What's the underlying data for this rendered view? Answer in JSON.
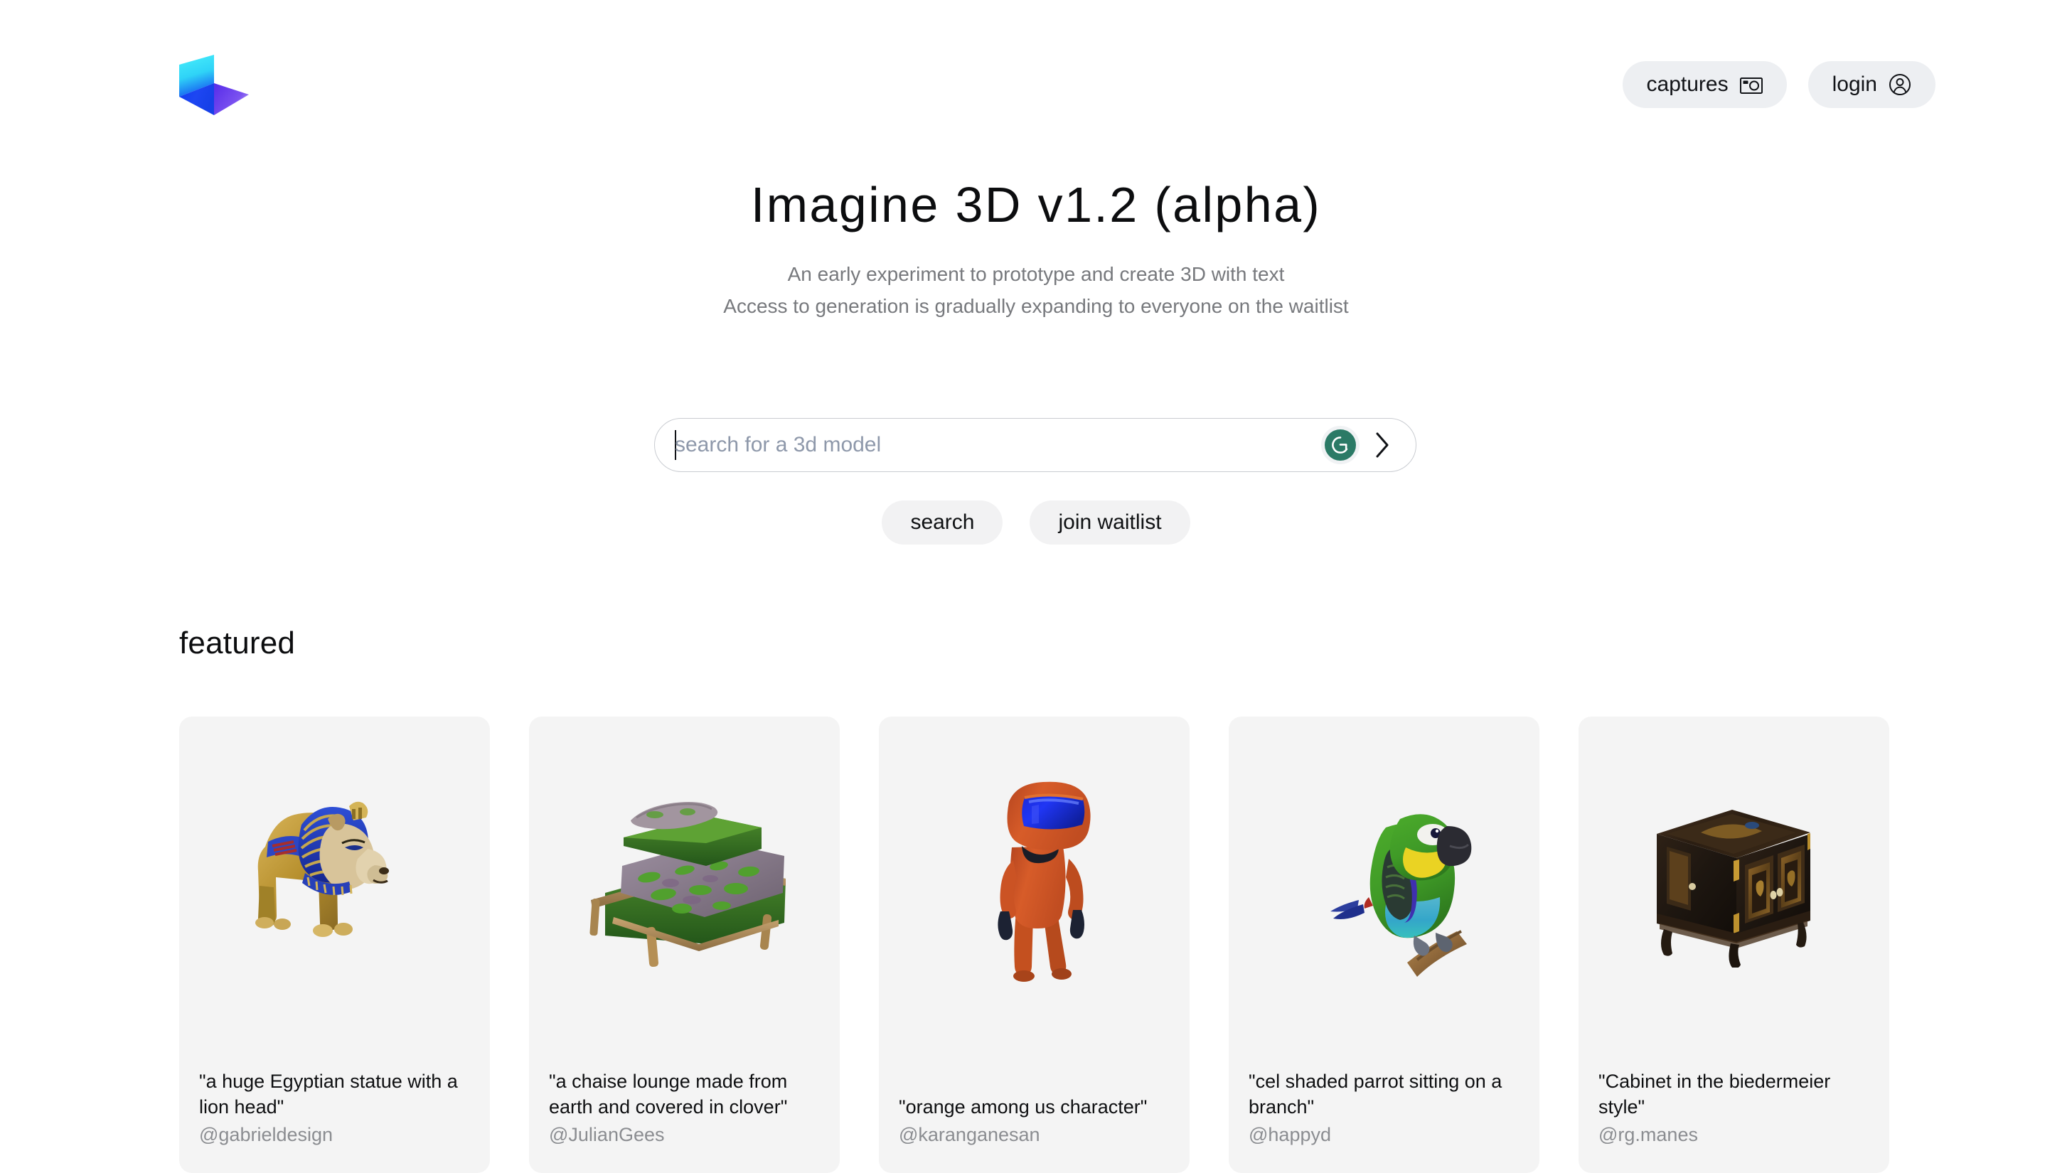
{
  "header": {
    "logo_name": "imagine-3d-logo",
    "captures_label": "captures",
    "captures_icon": "camera-icon",
    "login_label": "login",
    "login_icon": "user-circle-icon"
  },
  "hero": {
    "title": "Imagine 3D v1.2 (alpha)",
    "subtitle_line1": "An early experiment to prototype and create 3D with text",
    "subtitle_line2": "Access to generation is gradually expanding to everyone on the waitlist"
  },
  "search": {
    "value": "",
    "placeholder": "search for a 3d model",
    "grammarly_icon": "grammarly-icon",
    "submit_icon": "chevron-right-icon",
    "search_button": "search",
    "waitlist_button": "join waitlist"
  },
  "featured": {
    "heading": "featured",
    "cards": [
      {
        "thumb": "egyptian-lion-statue",
        "title": "\"a huge Egyptian statue with a lion head\"",
        "author": "@gabrieldesign"
      },
      {
        "thumb": "mossy-chaise-lounge",
        "title": "\"a chaise lounge made from earth and covered in clover\"",
        "author": "@JulianGees"
      },
      {
        "thumb": "orange-among-us-character",
        "title": "\"orange among us character\"",
        "author": "@karanganesan"
      },
      {
        "thumb": "cel-shaded-parrot",
        "title": "\"cel shaded parrot sitting on a branch\"",
        "author": "@happyd"
      },
      {
        "thumb": "biedermeier-cabinet",
        "title": "\"Cabinet in the biedermeier style\"",
        "author": "@rg.manes"
      }
    ]
  },
  "colors": {
    "background": "#ffffff",
    "card_bg": "#f4f4f4",
    "pill_bg": "#edeff2",
    "text_primary": "#0c0d0f",
    "text_muted": "#77797d",
    "author_muted": "#8b8d91",
    "placeholder": "#8e98aa",
    "grammarly_green": "#2b7a66",
    "logo_cyan": "#3ae5f5",
    "logo_blue": "#1b4bf0",
    "logo_purple": "#7b4ff0"
  }
}
